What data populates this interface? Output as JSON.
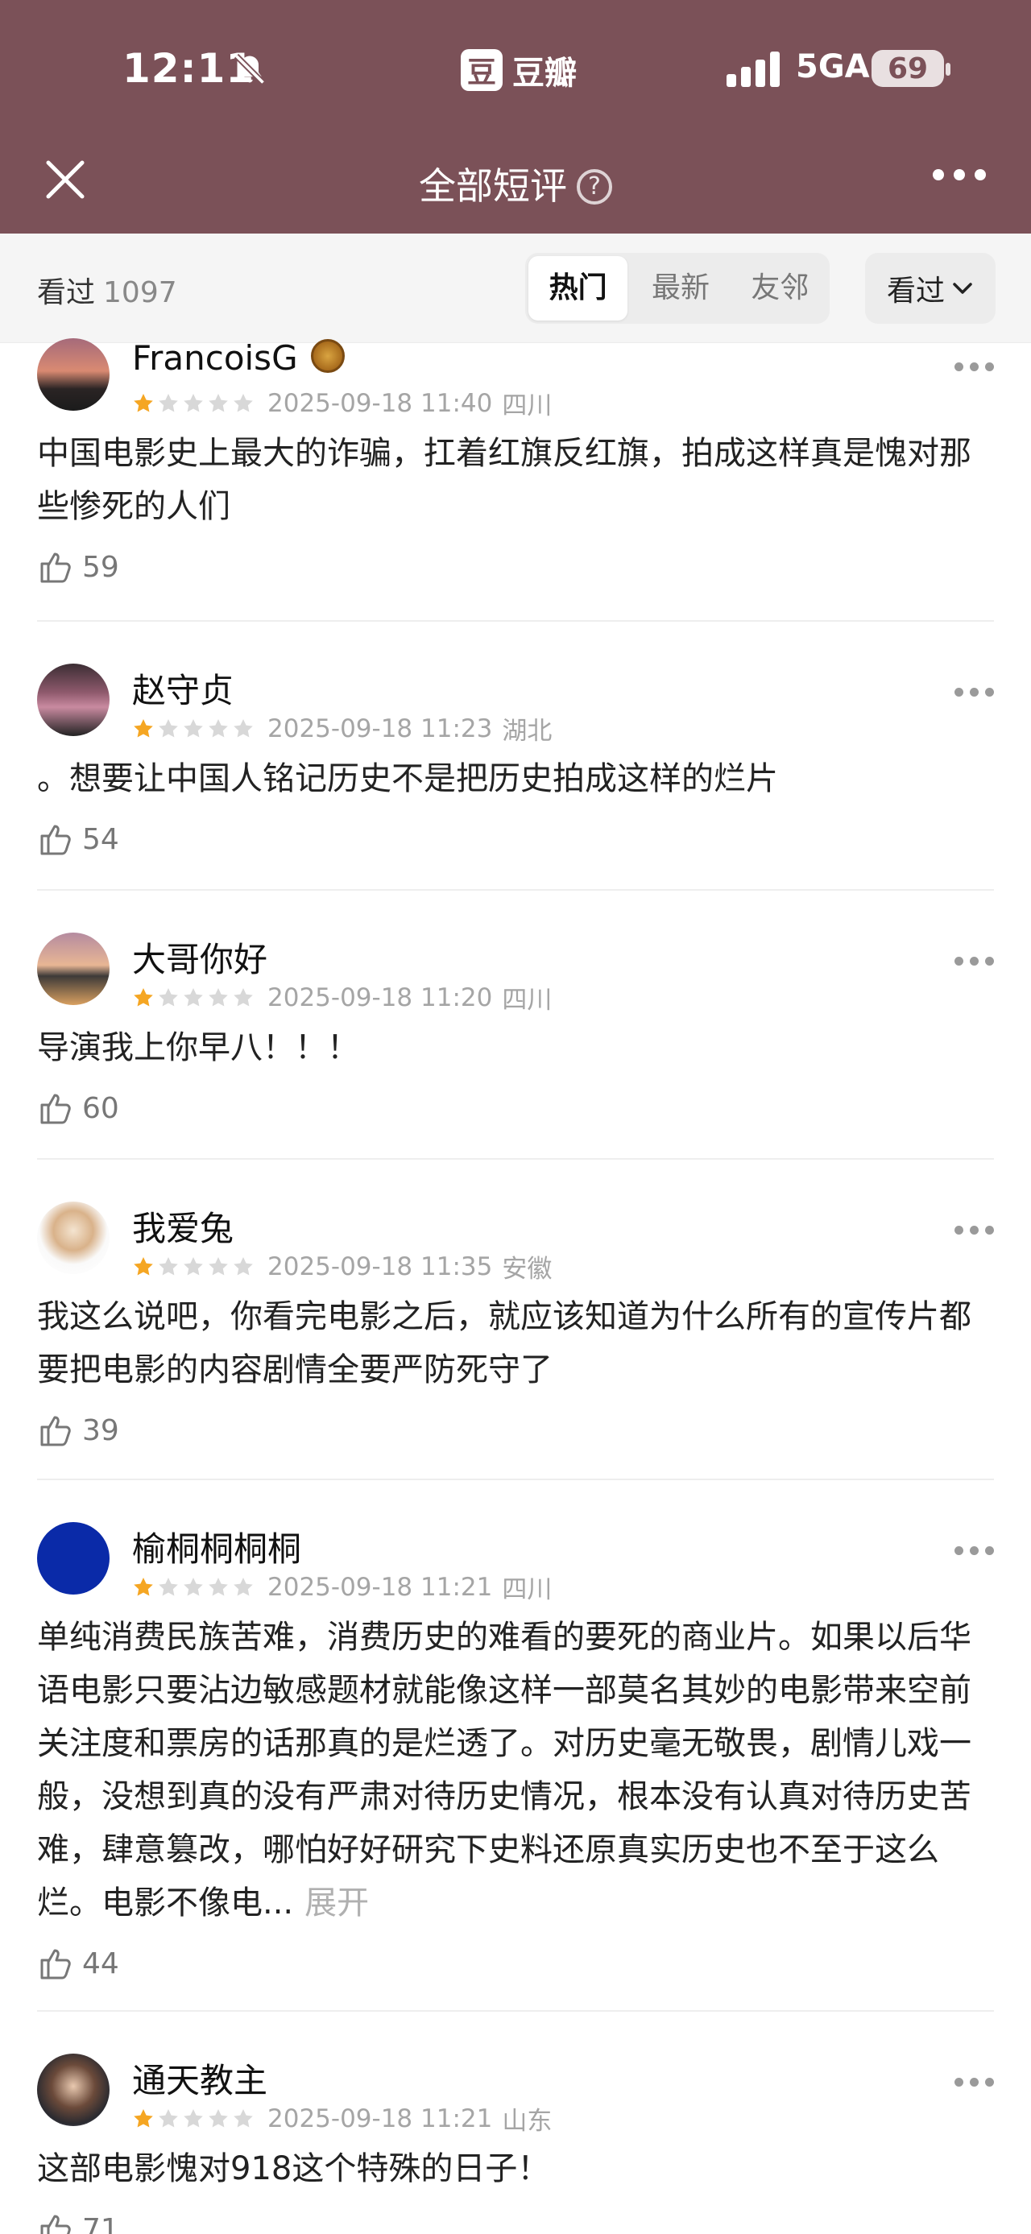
{
  "status_bar": {
    "time": "12:11",
    "app_name": "豆瓣",
    "app_logo": "豆",
    "network": "5GA",
    "battery": "69"
  },
  "header": {
    "title": "全部短评",
    "help_symbol": "?"
  },
  "filter": {
    "seen_label": "看过",
    "seen_count": "1097",
    "tabs": [
      "热门",
      "最新",
      "友邻"
    ],
    "active_tab": 0,
    "dropdown_label": "看过"
  },
  "colors": {
    "header_bg": "#7b5158",
    "star_on": "#f5a623",
    "star_off": "#d8d8d8"
  },
  "reviews": [
    {
      "user": "FrancoisG",
      "rating": 1,
      "date": "2025-09-18 11:40",
      "location": "四川",
      "text": "中国电影史上最大的诈骗，扛着红旗反红旗，拍成这样真是愧对那些惨死的人们",
      "likes": "59"
    },
    {
      "user": "赵守贞",
      "rating": 1,
      "date": "2025-09-18 11:23",
      "location": "湖北",
      "text": "。想要让中国人铭记历史不是把历史拍成这样的烂片",
      "likes": "54"
    },
    {
      "user": "大哥你好",
      "rating": 1,
      "date": "2025-09-18 11:20",
      "location": "四川",
      "text": "导演我上你早八！！！",
      "likes": "60"
    },
    {
      "user": "我爱兔",
      "rating": 1,
      "date": "2025-09-18 11:35",
      "location": "安徽",
      "text": "我这么说吧，你看完电影之后，就应该知道为什么所有的宣传片都要把电影的内容剧情全要严防死守了",
      "likes": "39"
    },
    {
      "user": "榆桐桐桐桐",
      "rating": 1,
      "date": "2025-09-18 11:21",
      "location": "四川",
      "text": "单纯消费民族苦难，消费历史的难看的要死的商业片。如果以后华语电影只要沾边敏感题材就能像这样一部莫名其妙的电影带来空前关注度和票房的话那真的是烂透了。对历史毫无敬畏，剧情儿戏一般，没想到真的没有严肃对待历史情况，根本没有认真对待历史苦难，肆意篡改，哪怕好好研究下史料还原真实历史也不至于这么烂。电影不像电...",
      "expand": "展开",
      "likes": "44"
    },
    {
      "user": "通天教主",
      "rating": 1,
      "date": "2025-09-18 11:21",
      "location": "山东",
      "text": "这部电影愧对918这个特殊的日子！",
      "likes": "71"
    }
  ]
}
